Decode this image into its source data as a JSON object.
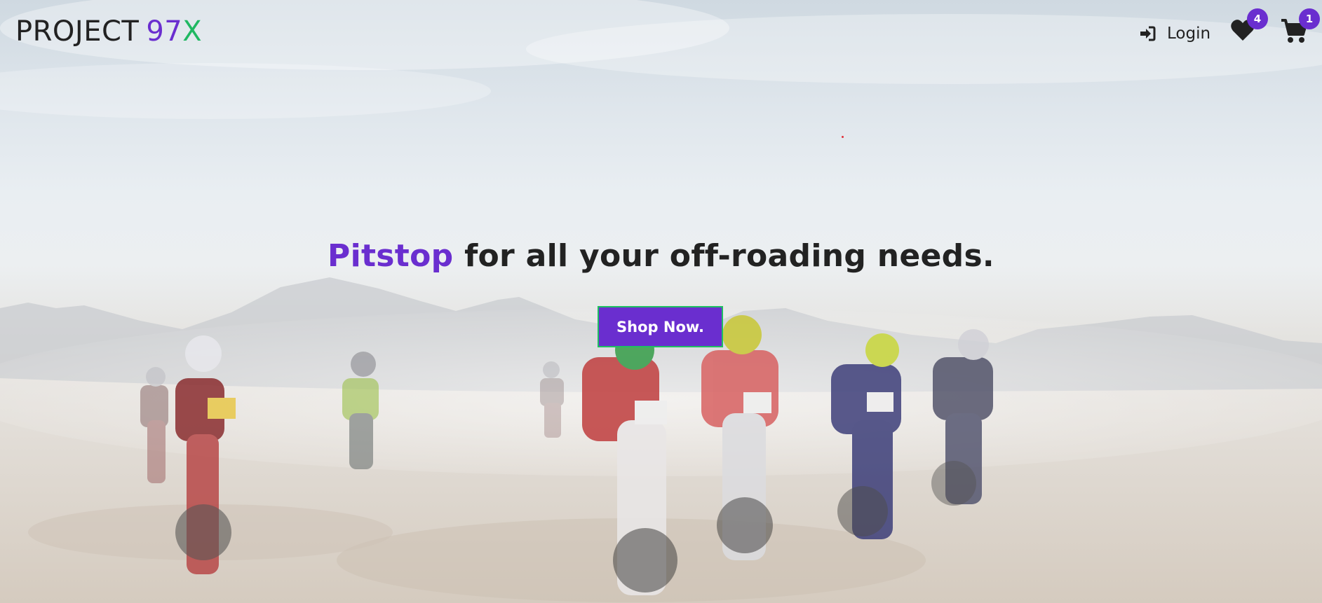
{
  "brand": {
    "word": "PROJECT",
    "num": "97",
    "x": "X"
  },
  "nav": {
    "login_label": "Login",
    "wishlist_count": "4",
    "cart_count": "1"
  },
  "icons": {
    "login": "sign-in-icon",
    "wishlist": "heart-icon",
    "cart": "cart-icon"
  },
  "hero": {
    "accent_word": "Pitstop",
    "headline_rest": " for all your off-roading needs.",
    "cta_label": "Shop Now.",
    "background": "desert-motocross-rally-photo"
  },
  "colors": {
    "accent": "#6a2ecf",
    "green": "#20b862",
    "text": "#222222"
  }
}
